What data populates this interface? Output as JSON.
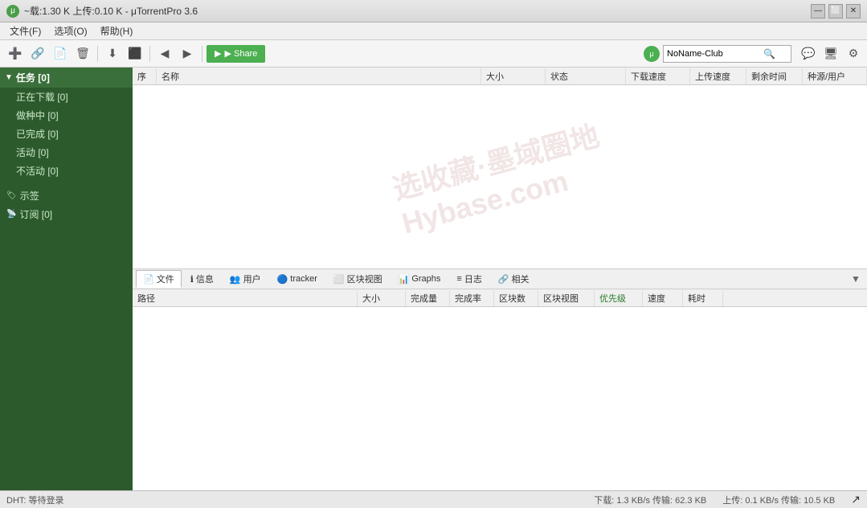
{
  "window": {
    "title": "~载:1.30 K 上传:0.10 K - μTorrentPro 3.6",
    "icon": "μ"
  },
  "menu": {
    "items": [
      "文件(F)",
      "选项(O)",
      "帮助(H)"
    ]
  },
  "toolbar": {
    "add_label": "+",
    "magnet_label": "🔗",
    "create_label": "📄",
    "delete_label": "🗑",
    "download_label": "⬇",
    "stop_label": "⬛",
    "prev_label": "◀",
    "next_label": "▶",
    "share_label": "▶ Share",
    "search_placeholder": "NoName-Club",
    "search_value": "NoName-Club",
    "chat_icon": "💬",
    "monitor_icon": "🖥",
    "settings_icon": "⚙"
  },
  "sidebar": {
    "main_label": "任务 [0]",
    "items": [
      {
        "label": "正在下载 [0]",
        "active": false
      },
      {
        "label": "做种中 [0]",
        "active": false
      },
      {
        "label": "已完成 [0]",
        "active": false
      },
      {
        "label": "活动 [0]",
        "active": false
      },
      {
        "label": "不活动 [0]",
        "active": false
      }
    ],
    "labels_label": "示签",
    "feeds_label": "订阅 [0]"
  },
  "torrent_list": {
    "columns": [
      "序",
      "名称",
      "大小",
      "状态",
      "下载速度",
      "上传速度",
      "剩余时间",
      "种源/用户"
    ],
    "rows": []
  },
  "bottom_tabs": {
    "tabs": [
      {
        "label": "文件",
        "icon": "📄",
        "active": true
      },
      {
        "label": "信息",
        "icon": "ℹ"
      },
      {
        "label": "用户",
        "icon": "👥"
      },
      {
        "label": "tracker",
        "icon": "🔵"
      },
      {
        "label": "区块视图",
        "icon": "⬜"
      },
      {
        "label": "Graphs",
        "icon": "📊"
      },
      {
        "label": "日志",
        "icon": "≡"
      },
      {
        "label": "相关",
        "icon": "🔗"
      }
    ]
  },
  "files_panel": {
    "columns": [
      "路径",
      "大小",
      "完成量",
      "完成率",
      "区块数",
      "区块视图",
      "优先级",
      "速度",
      "耗时"
    ],
    "rows": []
  },
  "status_bar": {
    "dht": "DHT: 等待登录",
    "download": "下载: 1.3 KB/s 传输: 62.3 KB",
    "upload": "上传: 0.1 KB/s 传输: 10.5 KB"
  }
}
